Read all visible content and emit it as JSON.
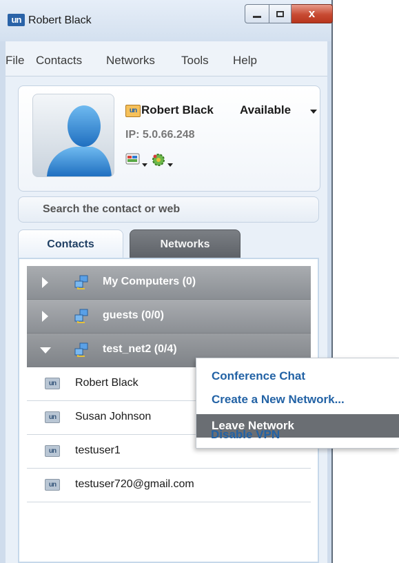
{
  "window": {
    "title": "Robert Black",
    "logo_text": "un",
    "minimize_icon": "minimize-icon",
    "maximize_icon": "maximize-icon",
    "close_glyph": "x"
  },
  "menu": [
    "File",
    "Contacts",
    "Networks",
    "Tools",
    "Help"
  ],
  "profile": {
    "name": "Robert Black",
    "status": "Available",
    "ip": "IP: 5.0.66.248",
    "status_icon_text": "un",
    "tool_icons": [
      "talk-icon",
      "settings-gear-icon"
    ]
  },
  "search": {
    "placeholder": "Search the contact or web",
    "value": ""
  },
  "tabs": {
    "contacts": "Contacts",
    "networks": "Networks",
    "active": "Contacts"
  },
  "tree": {
    "groups": [
      {
        "label": "My Computers (0)",
        "expanded": false
      },
      {
        "label": "guests (0/0)",
        "expanded": false
      },
      {
        "label": "test_net2 (0/4)",
        "expanded": true
      }
    ],
    "members": [
      "Robert Black",
      "Susan Johnson",
      "testuser1",
      "testuser720@gmail.com"
    ],
    "member_icon_text": "un"
  },
  "context_menu": {
    "items": [
      "Conference Chat",
      "Create a New Network...",
      "Leave Network",
      "Disable VPN"
    ],
    "highlighted": "Leave Network"
  },
  "colors": {
    "accent_blue": "#2262a5",
    "group_gray": "#8b8f94",
    "highlight_gray": "#6a6e73",
    "close_red": "#c74a32"
  }
}
